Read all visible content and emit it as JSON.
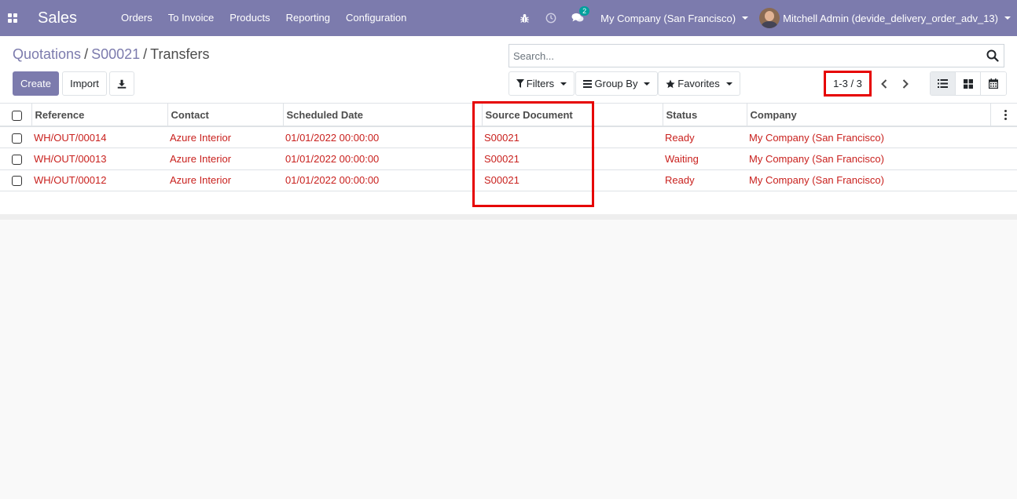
{
  "navbar": {
    "app_name": "Sales",
    "menu": [
      "Orders",
      "To Invoice",
      "Products",
      "Reporting",
      "Configuration"
    ],
    "messages_count": "2",
    "company": "My Company (San Francisco)",
    "user": "Mitchell Admin (devide_delivery_order_adv_13)",
    "bg_color": "#7c7bad"
  },
  "breadcrumb": {
    "items": [
      "Quotations",
      "S00021"
    ],
    "current": "Transfers"
  },
  "buttons": {
    "create": "Create",
    "import": "Import"
  },
  "search": {
    "placeholder": "Search..."
  },
  "filters": {
    "filters_label": "Filters",
    "group_by_label": "Group By",
    "favorites_label": "Favorites"
  },
  "pager": {
    "value": "1-3 / 3"
  },
  "table": {
    "columns": [
      "Reference",
      "Contact",
      "Scheduled Date",
      "Source Document",
      "Status",
      "Company"
    ],
    "rows": [
      {
        "reference": "WH/OUT/00014",
        "contact": "Azure Interior",
        "scheduled_date": "01/01/2022 00:00:00",
        "source_document": "S00021",
        "status": "Ready",
        "company": "My Company (San Francisco)"
      },
      {
        "reference": "WH/OUT/00013",
        "contact": "Azure Interior",
        "scheduled_date": "01/01/2022 00:00:00",
        "source_document": "S00021",
        "status": "Waiting",
        "company": "My Company (San Francisco)"
      },
      {
        "reference": "WH/OUT/00012",
        "contact": "Azure Interior",
        "scheduled_date": "01/01/2022 00:00:00",
        "source_document": "S00021",
        "status": "Ready",
        "company": "My Company (San Francisco)"
      }
    ]
  },
  "colors": {
    "accent": "#7c7bad",
    "link_red": "#c9211e",
    "highlight": "#e60000"
  }
}
